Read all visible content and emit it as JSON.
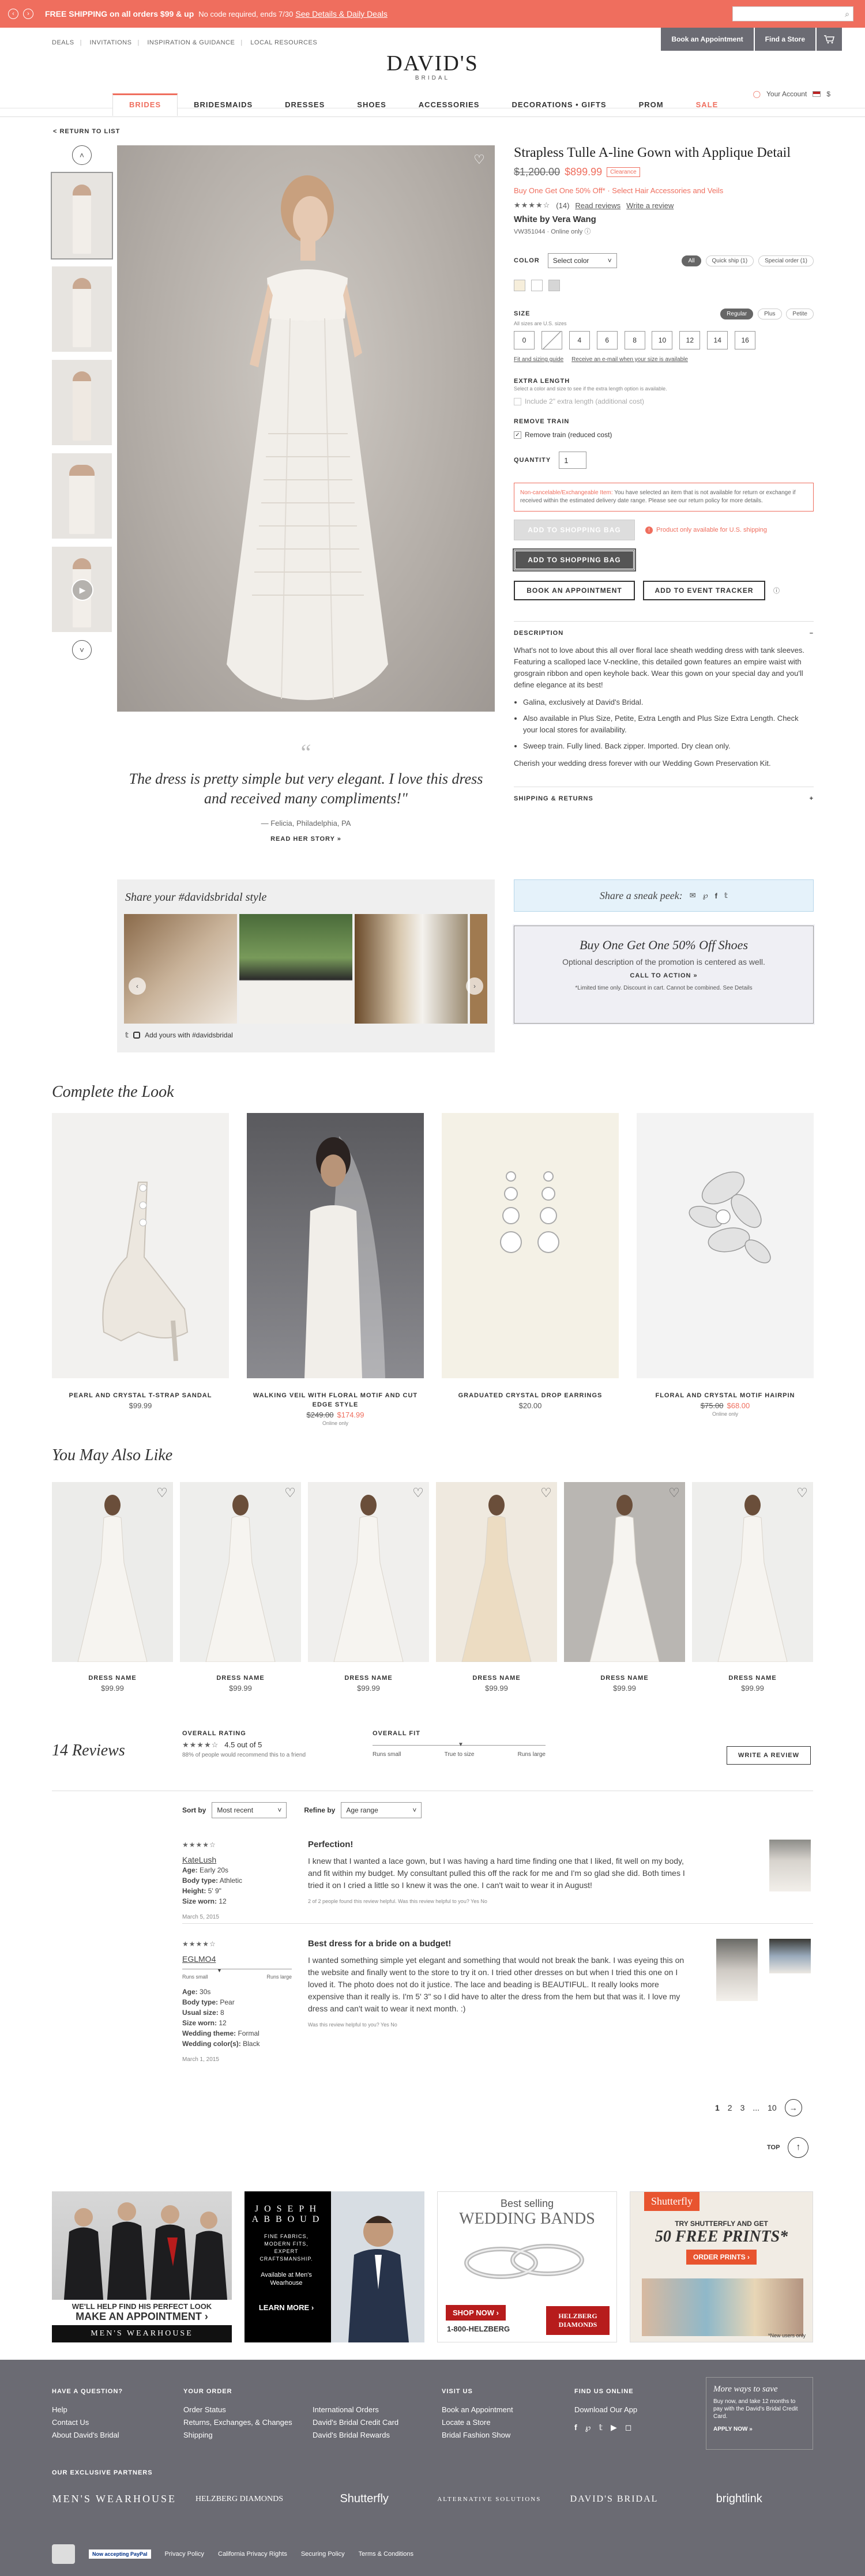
{
  "promo": {
    "arrow": "›",
    "bold": "FREE SHIPPING on all orders $99 & up",
    "text": "No code required, ends 7/30",
    "link": "See Details & Daily Deals"
  },
  "header": {
    "utility": [
      "DEALS",
      "INVITATIONS",
      "INSPIRATION & GUIDANCE",
      "LOCAL RESOURCES"
    ],
    "book": "Book an Appointment",
    "store": "Find a Store",
    "logo": "DAVID'S",
    "logo_sub": "BRIDAL",
    "account": "Your Account",
    "flag": "$"
  },
  "nav": [
    "BRIDES",
    "BRIDESMAIDS",
    "DRESSES",
    "SHOES",
    "ACCESSORIES",
    "DECORATIONS • GIFTS",
    "PROM",
    "SALE"
  ],
  "return_link": "< RETURN TO LIST",
  "product": {
    "title": "Strapless Tulle A-line Gown with Applique Detail",
    "price_old": "$1,200.00",
    "price_new": "$899.99",
    "badge": "Clearance",
    "promo": "Buy One Get One 50% Off* · Select Hair Accessories and Veils",
    "stars": "★★★★☆",
    "review_count": "(14)",
    "read_reviews": "Read reviews",
    "write_review": "Write a review",
    "brand": "White by Vera Wang",
    "sku": "VW351044",
    "online_only": "Online only",
    "color_label": "COLOR",
    "color_select": "Select color",
    "color_filters": [
      "All",
      "Quick ship (1)",
      "Special order (1)"
    ],
    "size_label": "SIZE",
    "size_note": "All sizes are U.S. sizes",
    "size_filters": [
      "Regular",
      "Plus",
      "Petite"
    ],
    "sizes": [
      "0",
      "2",
      "4",
      "6",
      "8",
      "10",
      "12",
      "14",
      "16"
    ],
    "fit_guide": "Fit and sizing guide",
    "notify": "Receive an e-mail when your size is available",
    "extra_label": "EXTRA LENGTH",
    "extra_note": "Select a color and size to see if the extra length option is available.",
    "extra_opt": "Include 2\" extra length (additional cost)",
    "train_label": "REMOVE TRAIN",
    "train_opt": "Remove train (reduced cost)",
    "qty_label": "QUANTITY",
    "qty": "1",
    "notice_title": "Non-cancelable/Exchangeable Item:",
    "notice": "You have selected an item that is not available for return or exchange if received within the estimated delivery date range. Please see our return policy for more details.",
    "add_bag_disabled": "ADD TO SHOPPING BAG",
    "us_only": "Product only available for U.S. shipping",
    "add_bag": "ADD TO SHOPPING BAG",
    "book_appt": "BOOK AN APPOINTMENT",
    "event_tracker": "ADD TO EVENT TRACKER",
    "desc_label": "DESCRIPTION",
    "desc_intro": "What's not to love about this all over floral lace sheath wedding dress with tank sleeves. Featuring a scalloped lace V-neckline, this detailed gown features an empire waist with grosgrain ribbon and open keyhole back. Wear this gown on your special day and you'll define elegance at its best!",
    "desc_bullets": [
      "Galina, exclusively at David's Bridal.",
      "Also available in Plus Size, Petite, Extra Length and Plus Size Extra Length. Check your local stores for availability.",
      "Sweep train. Fully lined. Back zipper. Imported. Dry clean only."
    ],
    "desc_outro": "Cherish your wedding dress forever with our Wedding Gown Preservation Kit.",
    "shipping_label": "SHIPPING & RETURNS"
  },
  "quote": {
    "mark": "“",
    "text": "The dress is pretty simple but very elegant. I love this dress and received many compliments!\"",
    "by": "— Felicia, Philadelphia, PA",
    "link": "READ HER STORY »"
  },
  "share": {
    "title": "Share your #davidsbridal style",
    "foot": "Add yours with #davidsbridal"
  },
  "sneak": {
    "title": "Share a sneak peek:"
  },
  "bogo": {
    "title": "Buy One Get One 50% Off Shoes",
    "desc": "Optional description of the promotion is centered as well.",
    "cta": "CALL TO ACTION »",
    "fine": "*Limited time only. Discount in cart. Cannot be combined. See Details"
  },
  "complete": {
    "title": "Complete the Look",
    "items": [
      {
        "name": "PEARL AND CRYSTAL T-STRAP SANDAL",
        "price": "$99.99",
        "old": "",
        "new": "",
        "note": ""
      },
      {
        "name": "WALKING VEIL WITH FLORAL MOTIF AND CUT EDGE STYLE",
        "price": "",
        "old": "$249.00",
        "new": "$174.99",
        "note": "Online only"
      },
      {
        "name": "GRADUATED CRYSTAL DROP EARRINGS",
        "price": "$20.00",
        "old": "",
        "new": "",
        "note": ""
      },
      {
        "name": "FLORAL AND CRYSTAL MOTIF HAIRPIN",
        "price": "",
        "old": "$75.00",
        "new": "$68.00",
        "note": "Online only"
      }
    ]
  },
  "also": {
    "title": "You May Also Like",
    "items": [
      {
        "name": "DRESS NAME",
        "price": "$99.99"
      },
      {
        "name": "DRESS NAME",
        "price": "$99.99"
      },
      {
        "name": "DRESS NAME",
        "price": "$99.99"
      },
      {
        "name": "DRESS NAME",
        "price": "$99.99"
      },
      {
        "name": "DRESS NAME",
        "price": "$99.99"
      },
      {
        "name": "DRESS NAME",
        "price": "$99.99"
      }
    ]
  },
  "reviews": {
    "title": "14 Reviews",
    "overall_label": "OVERALL RATING",
    "overall_stars": "★★★★☆",
    "overall_value": "4.5 out of 5",
    "recommend": "88% of people would recommend this to a friend",
    "fit_label": "OVERALL FIT",
    "fit_scale": [
      "Runs small",
      "True to size",
      "Runs large"
    ],
    "write": "WRITE A REVIEW",
    "sort_label": "Sort by",
    "sort_value": "Most recent",
    "refine_label": "Refine by",
    "refine_value": "Age range",
    "items": [
      {
        "stars": "★★★★☆",
        "user": "KateLush",
        "age": "Early 20s",
        "body": "Athletic",
        "height": "5' 9\"",
        "size": "12",
        "date": "March 5, 2015",
        "title": "Perfection!",
        "text": "I knew that I wanted a lace gown, but I was having a hard time finding one that I liked, fit well on my body, and fit within my budget. My consultant pulled this off the rack for me and I'm so glad she did. Both times I tried it on I cried a little so I knew it was the one. I can't wait to wear it in August!",
        "help": "2 of 2 people found this review helpful. Was this review helpful to you?  Yes  No"
      },
      {
        "stars": "★★★★☆",
        "user": "EGLMO4",
        "fit_small": "Runs small",
        "fit_large": "Runs large",
        "age": "30s",
        "body": "Pear",
        "usual": "8",
        "size": "12",
        "theme": "Formal",
        "wcolor": "Black",
        "date": "March 1, 2015",
        "title": "Best dress for a bride on a budget!",
        "text": "I wanted something simple yet elegant and something that would not break the bank. I was eyeing this on the website and finally went to the store to try it on. I tried other dresses on but when I tried this one on I loved it. The photo does not do it justice. The lace and beading is BEAUTIFUL. It really looks more expensive than it really is. I'm 5' 3\" so I did have to alter the dress from the hem but that was it. I love my dress and can't wait to wear it next month. :)",
        "help": "Was this review helpful to you?  Yes  No"
      }
    ],
    "pages": [
      "1",
      "2",
      "3",
      "...",
      "10"
    ],
    "top": "TOP"
  },
  "ads": {
    "mw": {
      "line1": "WE'LL HELP FIND HIS PERFECT LOOK",
      "line2": "MAKE AN APPOINTMENT ›",
      "line3": "MEN'S WEARHOUSE"
    },
    "ja": {
      "line1": "J O S E P H",
      "line2": "A B B O U D",
      "line3": "FINE FABRICS, MODERN FITS, EXPERT CRAFTSMANSHIP.",
      "line4": "Available at Men's Wearhouse",
      "line5": "LEARN MORE ›"
    },
    "hz": {
      "line1": "Best selling",
      "line2": "WEDDING BANDS",
      "line3": "SHOP NOW ›",
      "line4": "1-800-HELZBERG",
      "line5": "HELZBERG DIAMONDS"
    },
    "sf": {
      "line1": "Shutterfly",
      "line2": "TRY SHUTTERFLY AND GET",
      "line3": "50 FREE PRINTS*",
      "line4": "ORDER PRINTS ›",
      "line5": "*New users only"
    }
  },
  "footer": {
    "cols": [
      {
        "h": "HAVE A QUESTION?",
        "items": [
          "Help",
          "Contact Us",
          "About David's Bridal"
        ]
      },
      {
        "h": "YOUR ORDER",
        "items": [
          "Order Status",
          "Returns, Exchanges, & Changes",
          "Shipping"
        ]
      },
      {
        "h": "",
        "items": [
          "International Orders",
          "David's Bridal Credit Card",
          "David's Bridal Rewards"
        ]
      },
      {
        "h": "VISIT US",
        "items": [
          "Book an Appointment",
          "Locate a Store",
          "Bridal Fashion Show"
        ]
      },
      {
        "h": "FIND US ONLINE",
        "items": [
          "Download Our App"
        ]
      }
    ],
    "save_title": "More ways to save",
    "save_text": "Buy now, and take 12 months to pay with the David's Bridal Credit Card.",
    "save_cta": "APPLY NOW »",
    "partners_label": "OUR EXCLUSIVE PARTNERS",
    "partners": [
      "MEN'S WEARHOUSE",
      "HELZBERG DIAMONDS",
      "Shutterfly",
      "ALTERNATIVE SOLUTIONS",
      "DAVID'S BRIDAL",
      "brightlink"
    ],
    "links": [
      "Privacy Policy",
      "California Privacy Rights",
      "Securing Policy",
      "Terms & Conditions"
    ],
    "paypal": "Now accepting PayPal"
  }
}
